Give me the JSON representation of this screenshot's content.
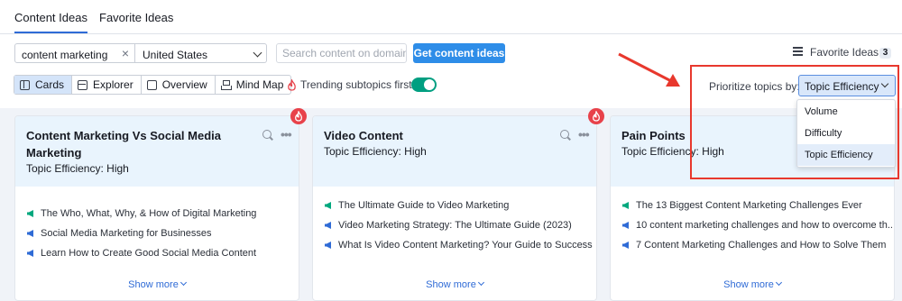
{
  "tabs": [
    {
      "label": "Content Ideas",
      "active": true
    },
    {
      "label": "Favorite Ideas",
      "active": false
    }
  ],
  "search": {
    "keyword_value": "content marketing",
    "country_value": "United States",
    "domain_placeholder": "Search content on domain",
    "submit_label": "Get content ideas"
  },
  "favorites": {
    "label": "Favorite Ideas",
    "count": "3"
  },
  "views": [
    {
      "label": "Cards",
      "icon": "cards-icon",
      "active": true
    },
    {
      "label": "Explorer",
      "icon": "table-icon",
      "active": false
    },
    {
      "label": "Overview",
      "icon": "overview-icon",
      "active": false
    },
    {
      "label": "Mind Map",
      "icon": "mindmap-icon",
      "active": false
    }
  ],
  "trending": {
    "label": "Trending subtopics first",
    "enabled": true
  },
  "prioritize": {
    "label": "Prioritize topics by:",
    "selected": "Topic Efficiency",
    "options": [
      "Volume",
      "Difficulty",
      "Topic Efficiency"
    ]
  },
  "cards": [
    {
      "title": "Content Marketing Vs Social Media Marketing",
      "efficiency": "Topic Efficiency: High",
      "headlines": [
        "The Who, What, Why, & How of Digital Marketing",
        "Social Media Marketing for Businesses",
        "Learn How to Create Good Social Media Content"
      ],
      "show_more": "Show more"
    },
    {
      "title": "Video Content",
      "efficiency": "Topic Efficiency: High",
      "headlines": [
        "The Ultimate Guide to Video Marketing",
        "Video Marketing Strategy: The Ultimate Guide (2023)",
        "What Is Video Content Marketing? Your Guide to Success"
      ],
      "show_more": "Show more"
    },
    {
      "title": "Pain Points",
      "efficiency": "Topic Efficiency: High",
      "headlines": [
        "The 13 Biggest Content Marketing Challenges Ever",
        "10 content marketing challenges and how to overcome th...",
        "7 Content Marketing Challenges and How to Solve Them"
      ],
      "show_more": "Show more"
    }
  ],
  "colors": {
    "accent": "#2e8de8",
    "highlight": "#e8382d",
    "card_header": "#e9f4fd",
    "trend_on": "#009f81"
  }
}
